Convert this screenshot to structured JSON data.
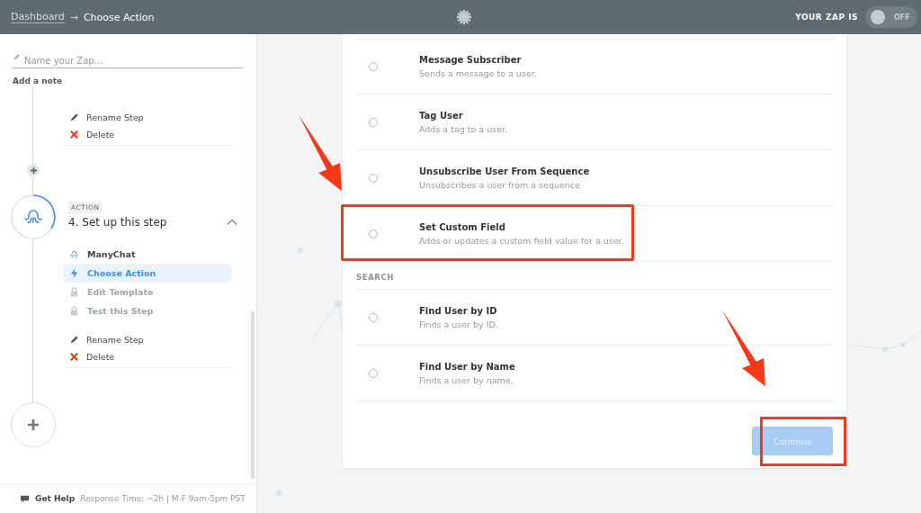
{
  "header": {
    "breadcrumb": [
      {
        "label": "Dashboard",
        "link": true
      },
      {
        "label": "Choose Action",
        "link": false
      }
    ],
    "separator": "→",
    "status_label": "YOUR ZAP IS",
    "toggle": {
      "on": false,
      "text": "OFF"
    }
  },
  "sidebar": {
    "name_field": {
      "placeholder": "Name your Zap..."
    },
    "add_note": "Add a note",
    "previous_step_menu": [
      {
        "kind": "rename",
        "label": "Rename Step"
      },
      {
        "kind": "delete",
        "label": "Delete"
      }
    ],
    "action_step": {
      "tag": "ACTION",
      "title": "4. Set up this step",
      "expanded": true,
      "items": [
        {
          "kind": "app",
          "label": "ManyChat",
          "selected": false,
          "disabled": false
        },
        {
          "kind": "action",
          "label": "Choose Action",
          "selected": true,
          "disabled": false
        },
        {
          "kind": "locked",
          "label": "Edit Template",
          "selected": false,
          "disabled": true
        },
        {
          "kind": "locked",
          "label": "Test this Step",
          "selected": false,
          "disabled": true
        }
      ],
      "menu": [
        {
          "kind": "rename",
          "label": "Rename Step"
        },
        {
          "kind": "delete",
          "label": "Delete"
        }
      ]
    },
    "footer": {
      "help": "Get Help",
      "response": "Response Time: ~2h | M-F 9am-5pm PST"
    }
  },
  "main": {
    "actions": [
      {
        "title": "Message Subscriber",
        "description": "Sends a message to a user.",
        "selected": false,
        "highlighted": false
      },
      {
        "title": "Tag User",
        "description": "Adds a tag to a user.",
        "selected": false,
        "highlighted": false
      },
      {
        "title": "Unsubscribe User From Sequence",
        "description": "Unsubscribes a user from a sequence",
        "selected": false,
        "highlighted": false
      },
      {
        "title": "Set Custom Field",
        "description": "Adds or updates a custom field value for a user.",
        "selected": false,
        "highlighted": true
      }
    ],
    "search_heading": "SEARCH",
    "searches": [
      {
        "title": "Find User by ID",
        "description": "Finds a user by ID.",
        "selected": false,
        "highlighted": false
      },
      {
        "title": "Find User by Name",
        "description": "Finds a user by name.",
        "selected": false,
        "highlighted": false
      }
    ],
    "continue_button": {
      "label": "Continue",
      "disabled": true,
      "highlighted": true
    }
  }
}
